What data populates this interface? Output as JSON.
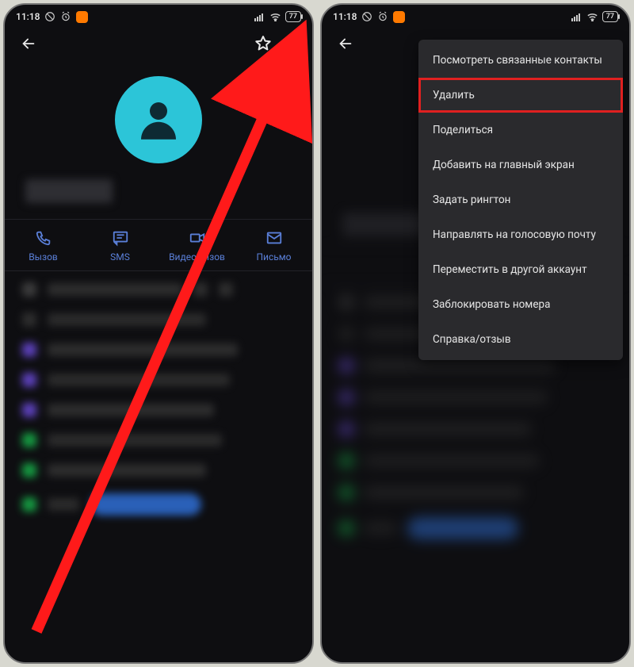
{
  "status": {
    "time": "11:18",
    "battery": "77"
  },
  "actions": {
    "call": "Вызов",
    "sms": "SMS",
    "video": "Видеовызов",
    "email": "Письмо"
  },
  "menu": {
    "view_linked": "Посмотреть связанные контакты",
    "delete": "Удалить",
    "share": "Поделиться",
    "add_home": "Добавить на главный экран",
    "set_ringtone": "Задать рингтон",
    "route_voicemail": "Направлять на голосовую почту",
    "move_account": "Переместить в другой аккаунт",
    "block": "Заблокировать номера",
    "help": "Справка/отзыв"
  }
}
